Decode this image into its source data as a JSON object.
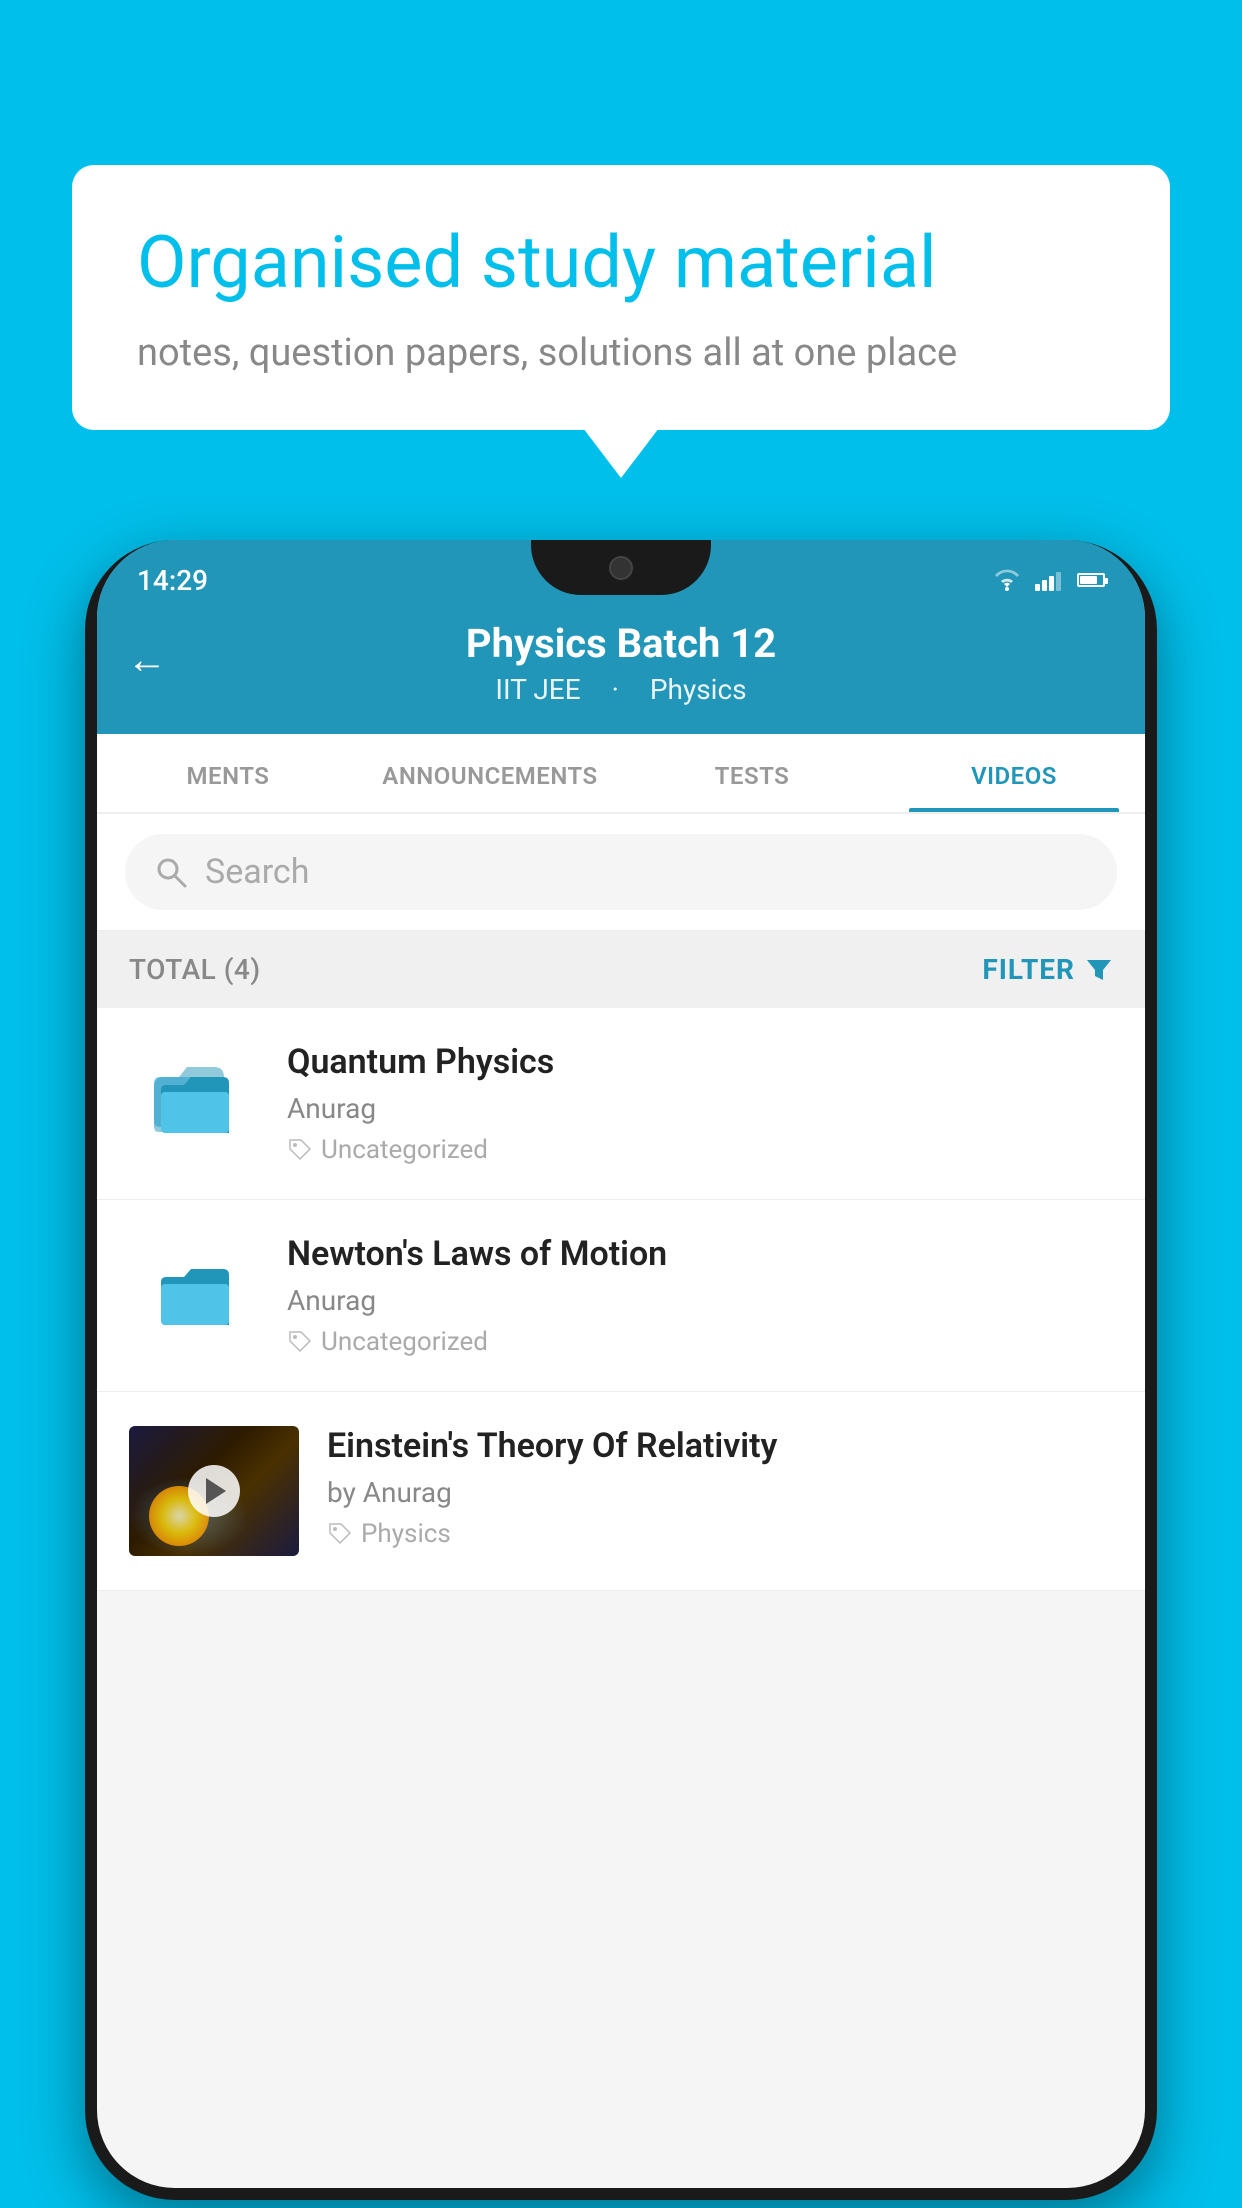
{
  "background": {
    "color": "#00BFEA"
  },
  "speech_bubble": {
    "title": "Organised study material",
    "subtitle": "notes, question papers, solutions all at one place"
  },
  "phone": {
    "status_bar": {
      "time": "14:29"
    },
    "header": {
      "title": "Physics Batch 12",
      "subtitle_part1": "IIT JEE",
      "subtitle_part2": "Physics",
      "back_label": "←"
    },
    "tabs": [
      {
        "label": "MENTS",
        "active": false
      },
      {
        "label": "ANNOUNCEMENTS",
        "active": false
      },
      {
        "label": "TESTS",
        "active": false
      },
      {
        "label": "VIDEOS",
        "active": true
      }
    ],
    "search": {
      "placeholder": "Search"
    },
    "filter_bar": {
      "total_label": "TOTAL (4)",
      "filter_label": "FILTER"
    },
    "videos": [
      {
        "title": "Quantum Physics",
        "author": "Anurag",
        "tag": "Uncategorized",
        "type": "folder"
      },
      {
        "title": "Newton's Laws of Motion",
        "author": "Anurag",
        "tag": "Uncategorized",
        "type": "folder"
      },
      {
        "title": "Einstein's Theory Of Relativity",
        "author": "by Anurag",
        "tag": "Physics",
        "type": "video"
      }
    ]
  }
}
